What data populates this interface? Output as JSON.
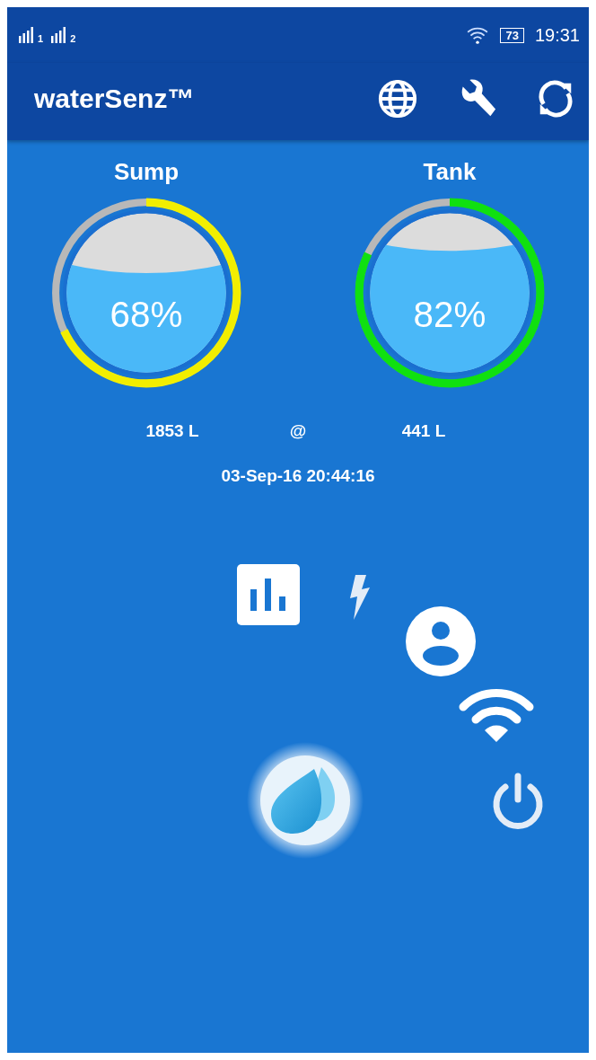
{
  "status_bar": {
    "sim_labels": [
      "1",
      "2"
    ],
    "battery": "73",
    "time": "19:31"
  },
  "app_bar": {
    "title": "waterSenz™"
  },
  "gauges": [
    {
      "label": "Sump",
      "percent": "68%",
      "level": 0.68,
      "color": "#f2ee00",
      "volume": "1853 L"
    },
    {
      "label": "Tank",
      "percent": "82%",
      "level": 0.82,
      "color": "#10e010",
      "volume": "441 L"
    }
  ],
  "separator": "@",
  "timestamp": "03-Sep-16 20:44:16"
}
